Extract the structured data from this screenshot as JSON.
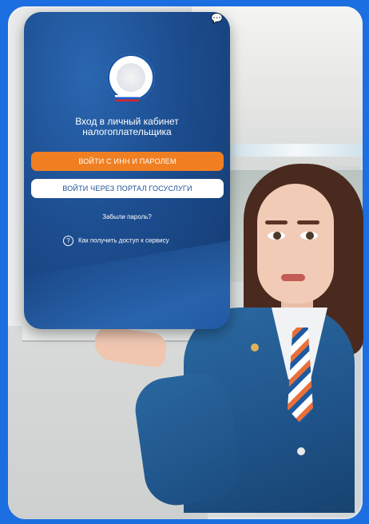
{
  "app": {
    "heading_line1": "Вход в личный кабинет",
    "heading_line2": "налогоплательщика",
    "buttons": {
      "login_inn": "ВОЙТИ С ИНН И ПАРОЛЕМ",
      "login_gosuslugi": "ВОЙТИ ЧЕРЕЗ ПОРТАЛ ГОСУСЛУГИ"
    },
    "forgot_password": "Забыли пароль?",
    "help_link": "Как получить доступ к сервису",
    "help_icon_symbol": "?",
    "chat_icon_symbol": "💬"
  },
  "colors": {
    "primary_orange": "#f07f22",
    "app_background": "#1c4d8f",
    "page_background": "#1c6fe0"
  }
}
